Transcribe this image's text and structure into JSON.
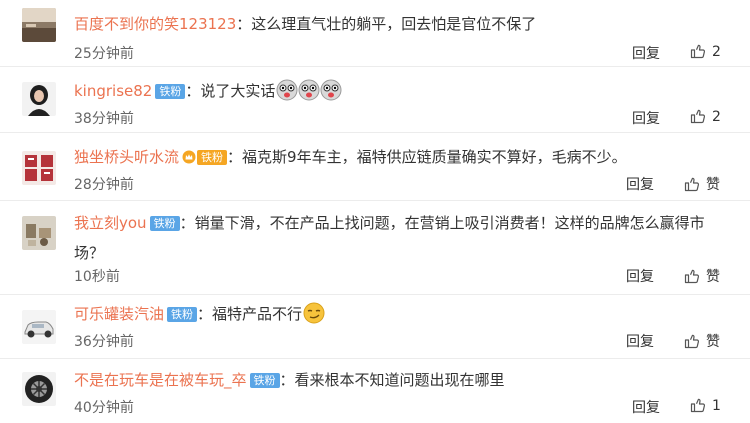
{
  "comments": [
    {
      "username": "百度不到你的笑123123",
      "badge": "",
      "text": "这么理直气壮的躺平，回去怕是官位不保了",
      "time": "25分钟前",
      "reply": "回复",
      "likes": "2"
    },
    {
      "username": "kingrise82",
      "badge": "铁粉",
      "text": "说了大实话",
      "time": "38分钟前",
      "reply": "回复",
      "likes": "2"
    },
    {
      "username": "独坐桥头听水流",
      "badge": "铁粉",
      "text": "福克斯9年车主，福特供应链质量确实不算好，毛病不少。",
      "time": "28分钟前",
      "reply": "回复",
      "likes": "赞"
    },
    {
      "username": "我立刻you",
      "badge": "铁粉",
      "text": "销量下滑，不在产品上找问题，在营销上吸引消费者！这样的品牌怎么赢得市场？",
      "time": "10秒前",
      "reply": "回复",
      "likes": "赞"
    },
    {
      "username": "可乐罐装汽油",
      "badge": "铁粉",
      "text": "福特产品不行",
      "time": "36分钟前",
      "reply": "回复",
      "likes": "赞"
    },
    {
      "username": "不是在玩车是在被车玩_卒",
      "badge": "铁粉",
      "text": "看来根本不知道问题出现在哪里",
      "time": "40分钟前",
      "reply": "回复",
      "likes": "1"
    }
  ],
  "icons": {
    "like": "thumbs-up-icon",
    "crown": "crown-icon"
  },
  "colors": {
    "username": "#eb7350",
    "badge": "#5aa5e6",
    "badge_gold": "#f5a623"
  }
}
